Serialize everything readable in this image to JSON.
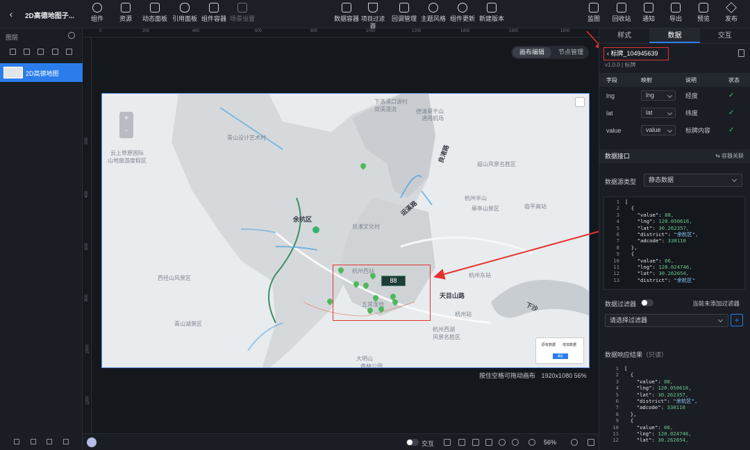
{
  "header": {
    "project_title": "2D高德地图子...",
    "tools_left": [
      {
        "label": "组件",
        "icon": "component-icon"
      },
      {
        "label": "资源",
        "icon": "resource-icon"
      },
      {
        "label": "动态面板",
        "icon": "dynamic-panel-icon"
      },
      {
        "label": "引用面板",
        "icon": "link-panel-icon"
      },
      {
        "label": "组件容器",
        "icon": "container-icon"
      },
      {
        "label": "场景设置",
        "icon": "scene-icon"
      }
    ],
    "tools_mid": [
      {
        "label": "数据容器",
        "icon": "data-container-icon"
      },
      {
        "label": "项目过滤器",
        "icon": "filter-icon"
      },
      {
        "label": "回调管理",
        "icon": "callback-icon"
      },
      {
        "label": "主题风格",
        "icon": "theme-icon"
      },
      {
        "label": "组件更新",
        "icon": "refresh-icon"
      },
      {
        "label": "新建版本",
        "icon": "new-version-icon"
      }
    ],
    "tools_right": [
      {
        "label": "监图",
        "icon": "monitor-icon"
      },
      {
        "label": "回收站",
        "icon": "trash-icon"
      },
      {
        "label": "通知",
        "icon": "notification-icon"
      },
      {
        "label": "导出",
        "icon": "export-icon"
      },
      {
        "label": "预览",
        "icon": "preview-icon"
      },
      {
        "label": "发布",
        "icon": "publish-icon"
      }
    ]
  },
  "layers": {
    "title": "图层",
    "items": [
      {
        "label": "2D高德地图"
      }
    ]
  },
  "ruler": {
    "h_ticks": [
      "0",
      "200",
      "400",
      "600",
      "800",
      "1000",
      "1200",
      "1400",
      "1600",
      "1800"
    ],
    "v_ticks": [
      "200",
      "400",
      "600",
      "800",
      "1000",
      "1200"
    ]
  },
  "canvas": {
    "mode_tabs": [
      "画布编辑",
      "节点管理"
    ],
    "status_hint": "按住空格可拖动画布",
    "resolution": "1920x1080",
    "zoom_percent": "56%",
    "marker_value": "88"
  },
  "map": {
    "labels": [
      {
        "text": "下洛溪口源村",
        "bold": false
      },
      {
        "text": "双溪漂流",
        "bold": false
      },
      {
        "text": "德清莫干山",
        "bold": false
      },
      {
        "text": "通用机场",
        "bold": false
      },
      {
        "text": "云上草原国际",
        "bold": false
      },
      {
        "text": "山地旅游度假区",
        "bold": false
      },
      {
        "text": "青山设计艺术村",
        "bold": false
      },
      {
        "text": "超山风景名胜区",
        "bold": false
      },
      {
        "text": "余杭区",
        "bold": true
      },
      {
        "text": "良渚文化村",
        "bold": false
      },
      {
        "text": "杭州半山",
        "bold": false
      },
      {
        "text": "皋亭山景区",
        "bold": false
      },
      {
        "text": "临平高站",
        "bold": false
      },
      {
        "text": "西径山风景区",
        "bold": false
      },
      {
        "text": "杭州西站",
        "bold": false
      },
      {
        "text": "杭州东站",
        "bold": false
      },
      {
        "text": "天目山路",
        "bold": true
      },
      {
        "text": "五常湿地",
        "bold": false
      },
      {
        "text": "杭州站",
        "bold": false
      },
      {
        "text": "青山湖景区",
        "bold": false
      },
      {
        "text": "杭州西湖",
        "bold": false
      },
      {
        "text": "风景名胜区",
        "bold": false
      },
      {
        "text": "大明山",
        "bold": false
      },
      {
        "text": "森林公园",
        "bold": false
      },
      {
        "text": "良渚路",
        "bold": true
      },
      {
        "text": "运溪路",
        "bold": true
      },
      {
        "text": "下沙",
        "bold": false
      }
    ],
    "legend": {
      "item1": "原有数据",
      "item2": "增加数据",
      "button": "确定"
    }
  },
  "bottom": {
    "interaction_label": "交互",
    "zoom": "56%"
  },
  "right_panel": {
    "tabs": [
      "样式",
      "数据",
      "交互"
    ],
    "active_tab": "数据",
    "component_title": "标牌_104945639",
    "version": "v1.0.0 | 标牌",
    "field_headers": [
      "字段",
      "映射",
      "说明",
      "状态"
    ],
    "fields": [
      {
        "field": "lng",
        "map": "lng",
        "desc": "经度"
      },
      {
        "field": "lat",
        "map": "lat",
        "desc": "纬度"
      },
      {
        "field": "value",
        "map": "value",
        "desc": "标牌内容"
      }
    ],
    "data_interface_title": "数据接口",
    "container_link": "容器关联",
    "source_type_label": "数据源类型",
    "source_type_value": "静态数据",
    "code_lines": [
      {
        "n": "1",
        "t": "["
      },
      {
        "n": "2",
        "t": "  {"
      },
      {
        "n": "3",
        "k": "\"value\"",
        "v": "88,"
      },
      {
        "n": "4",
        "k": "\"lng\"",
        "v": "120.050616,"
      },
      {
        "n": "5",
        "k": "\"lat\"",
        "v": "30.262357,"
      },
      {
        "n": "6",
        "k": "\"district\"",
        "v": "\"余杭区\","
      },
      {
        "n": "7",
        "k": "\"adcode\"",
        "v": "330110"
      },
      {
        "n": "8",
        "t": "  },"
      },
      {
        "n": "9",
        "t": "  {"
      },
      {
        "n": "10",
        "k": "\"value\"",
        "v": "66,"
      },
      {
        "n": "11",
        "k": "\"lng\"",
        "v": "120.024746,"
      },
      {
        "n": "12",
        "k": "\"lat\"",
        "v": "30.262654,"
      },
      {
        "n": "13",
        "k": "\"district\"",
        "v": "\"余杭区\""
      }
    ],
    "filter_label": "数据过滤器",
    "filter_status": "当前未添加过滤器",
    "filter_placeholder": "请选择过滤器",
    "response_title": "数据响应结果",
    "response_readonly": "（只读）",
    "response_lines": [
      {
        "n": "1",
        "t": "["
      },
      {
        "n": "2",
        "t": "  {"
      },
      {
        "n": "3",
        "k": "\"value\"",
        "v": "88,"
      },
      {
        "n": "4",
        "k": "\"lng\"",
        "v": "120.050616,"
      },
      {
        "n": "5",
        "k": "\"lat\"",
        "v": "30.262357,"
      },
      {
        "n": "6",
        "k": "\"district\"",
        "v": "\"余杭区\","
      },
      {
        "n": "7",
        "k": "\"adcode\"",
        "v": "330110"
      },
      {
        "n": "8",
        "t": "  },"
      },
      {
        "n": "9",
        "t": "  {"
      },
      {
        "n": "10",
        "k": "\"value\"",
        "v": "66,"
      },
      {
        "n": "11",
        "k": "\"lng\"",
        "v": "120.024746,"
      },
      {
        "n": "12",
        "k": "\"lat\"",
        "v": "30.262654,"
      }
    ]
  }
}
